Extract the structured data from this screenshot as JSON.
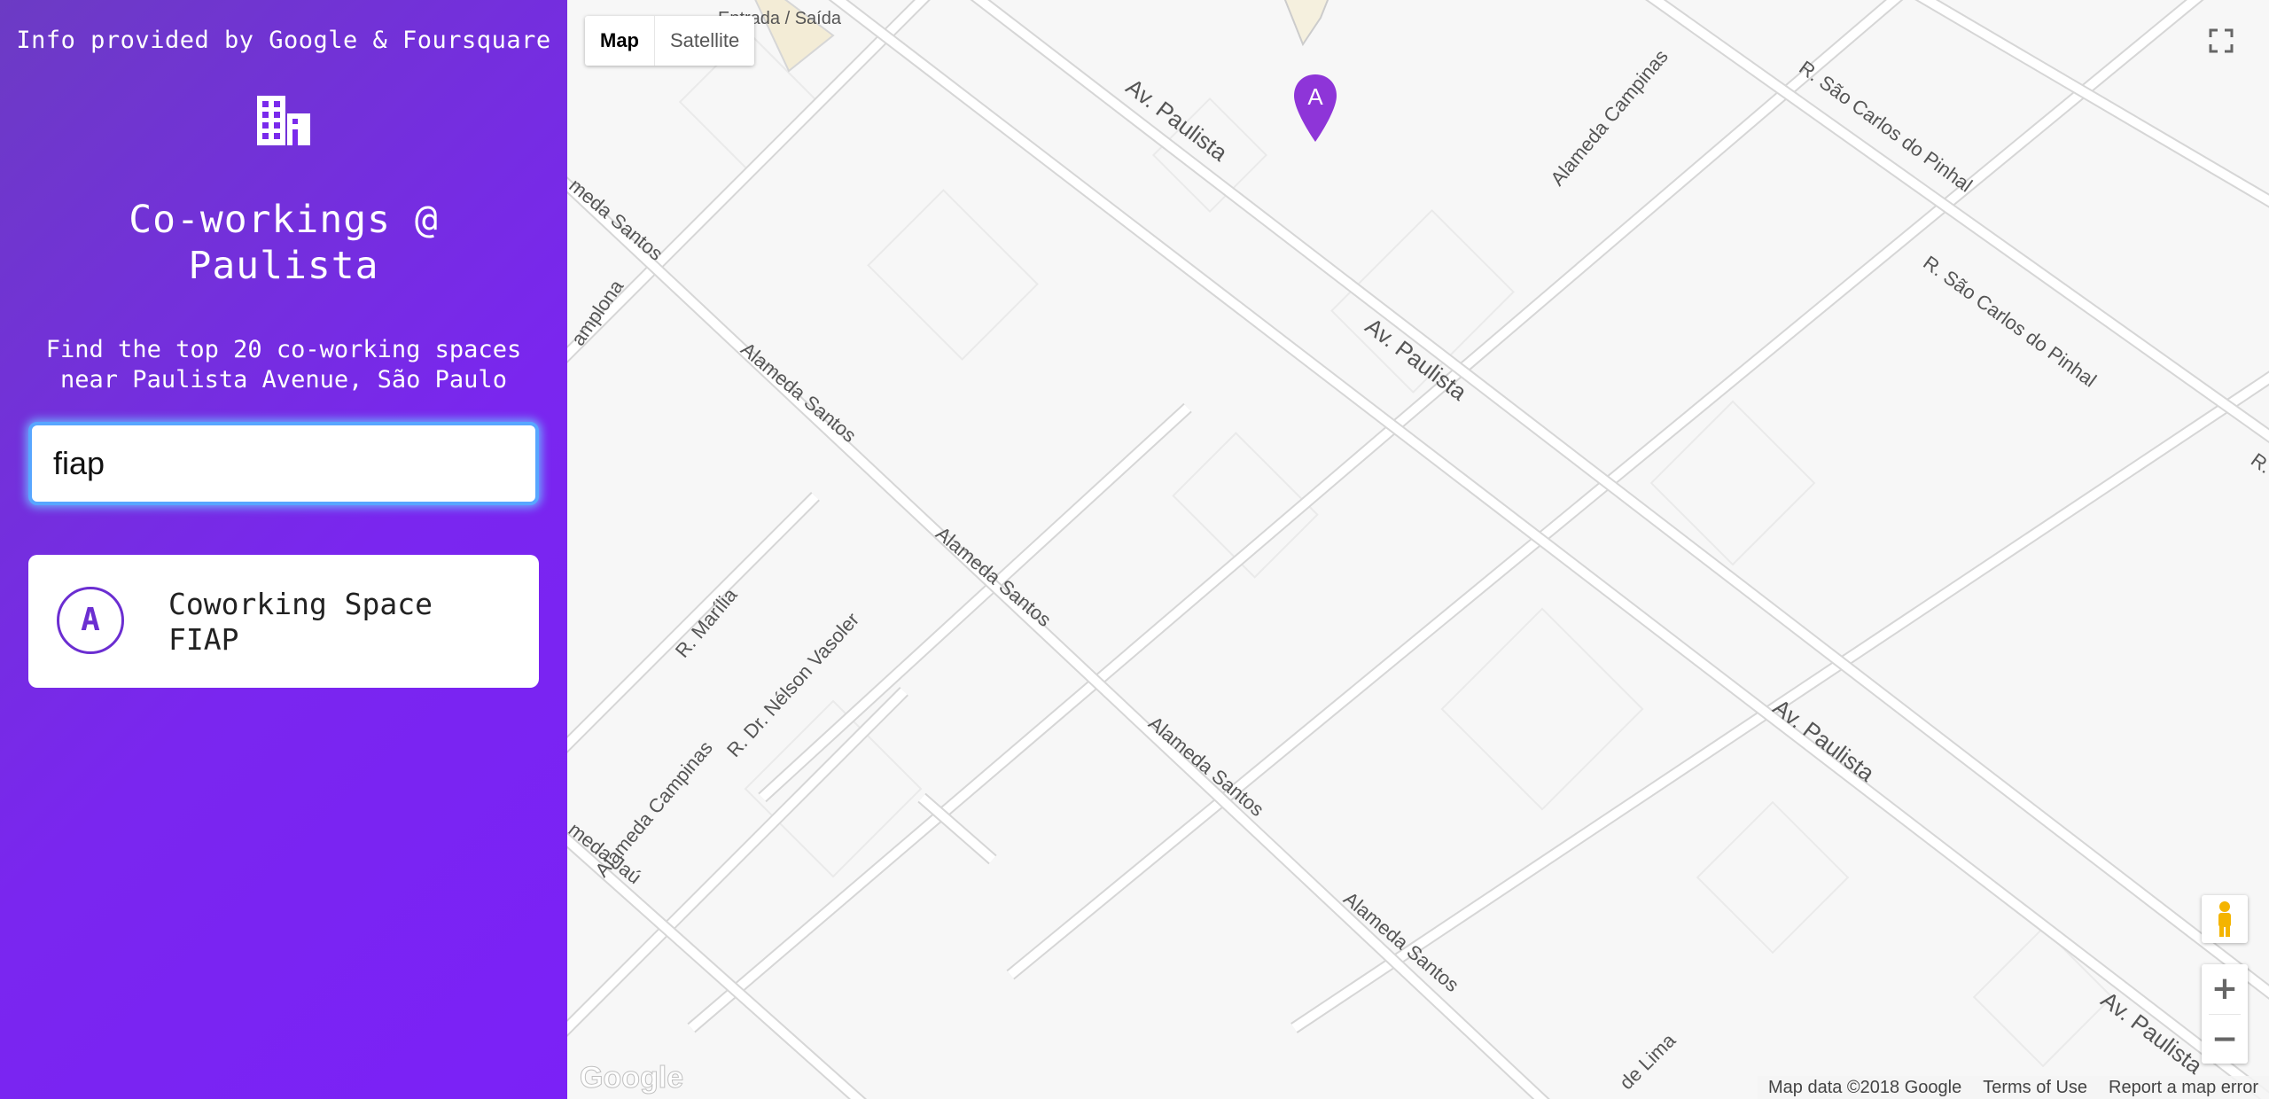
{
  "sidebar": {
    "credit": "Info provided by Google & Foursquare",
    "icon": "building-icon",
    "title": "Co-workings @ Paulista",
    "subtitle": "Find the top 20 co-working spaces near Paulista Avenue, São Paulo",
    "search": {
      "value": "fiap",
      "placeholder": ""
    },
    "results": [
      {
        "marker": "A",
        "name": "Coworking Space FIAP"
      }
    ],
    "accent_color": "#6b2ed1"
  },
  "map": {
    "map_types": {
      "map": "Map",
      "satellite": "Satellite",
      "selected": "Map"
    },
    "marker": {
      "label": "A",
      "color": "#8e35d8"
    },
    "street_labels": {
      "entrada": "Entrada / Saída",
      "paulista": "Av. Paulista",
      "campinas": "Alameda Campinas",
      "santos": "Alameda Santos",
      "santos_cut": "meda Santos",
      "sao_carlos": "R. São Carlos do Pinhal",
      "r_cut": "R.",
      "pamplona_cut": "amplona",
      "marilia": "R. Marília",
      "nelson": "R. Dr. Nélson Vasoler",
      "jau_cut": "meda Jaú",
      "lima_cut": "de Lima"
    },
    "controls": {
      "zoom_in": "+",
      "zoom_out": "−",
      "fullscreen": "fullscreen-icon",
      "street_view": "pegman-icon"
    },
    "footer": {
      "map_data": "Map data ©2018 Google",
      "terms": "Terms of Use",
      "report": "Report a map error"
    },
    "logo": "Google"
  }
}
